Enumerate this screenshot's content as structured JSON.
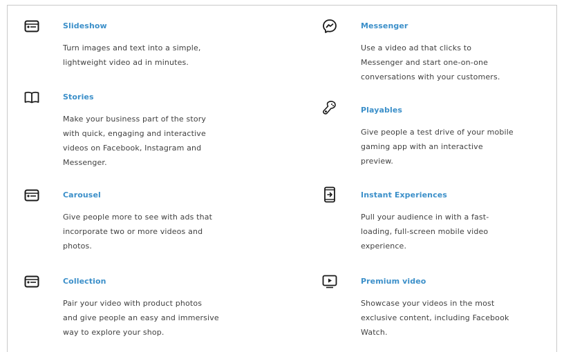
{
  "left_column": [
    {
      "title": "Slideshow",
      "icon": "slideshow-icon",
      "lines": [
        "Turn images and text into a simple,",
        "lightweight video ad in minutes."
      ]
    },
    {
      "title": "Stories",
      "icon": "book-icon",
      "lines": [
        "Make your business part of the story",
        "with quick, engaging and interactive",
        "videos on Facebook, Instagram and",
        "Messenger."
      ]
    },
    {
      "title": "Carousel",
      "icon": "carousel-icon",
      "lines": [
        "Give people more to see with ads that",
        "incorporate two or more videos and",
        "photos."
      ]
    },
    {
      "title": "Collection",
      "icon": "collection-icon",
      "lines": [
        "Pair your video with product photos",
        "and give people an easy and immersive",
        "way to explore your shop."
      ]
    }
  ],
  "right_column": [
    {
      "title": "Messenger",
      "icon": "messenger-icon",
      "lines": [
        "Use a video ad that clicks to",
        "Messenger and start one-on-one",
        "conversations with your customers."
      ]
    },
    {
      "title": "Playables",
      "icon": "game-controller-icon",
      "lines": [
        "Give people a test drive of your mobile",
        "gaming app with an interactive",
        "preview."
      ]
    },
    {
      "title": "Instant Experiences",
      "icon": "mobile-phone-icon",
      "lines": [
        "Pull your audience in with a fast-",
        "loading, full-screen mobile video",
        "experience."
      ]
    },
    {
      "title": "Premium video",
      "icon": "play-screen-icon",
      "lines": [
        "Showcase your videos in the most",
        "exclusive content, including Facebook",
        "Watch."
      ]
    }
  ],
  "colors": {
    "title": "#3b8fc9",
    "text": "#3f3f3f",
    "icon": "#1a1a1a"
  }
}
